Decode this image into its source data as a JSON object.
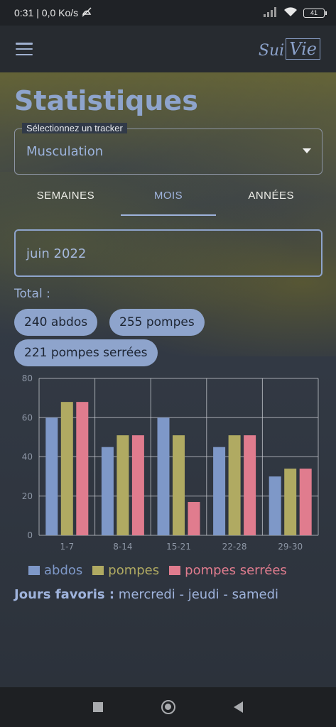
{
  "status": {
    "time": "0:31",
    "speed": "| 0,0 Ko/s",
    "battery": "41"
  },
  "app": {
    "logo_left": "Sui",
    "logo_right": "Vie"
  },
  "page": {
    "title": "Statistiques",
    "tracker_label": "Sélectionnez un tracker",
    "tracker_value": "Musculation",
    "tabs": [
      {
        "label": "SEMAINES",
        "active": false
      },
      {
        "label": "MOIS",
        "active": true
      },
      {
        "label": "ANNÉES",
        "active": false
      }
    ],
    "month_value": "juin 2022",
    "total_label": "Total :",
    "chips": [
      "240 abdos",
      "255 pompes",
      "221 pompes serrées"
    ],
    "favs_label": "Jours favoris :",
    "favs_value": "mercredi - jeudi - samedi"
  },
  "colors": {
    "abdos": "#7e98c8",
    "pompes": "#b0aa62",
    "pompes_serrees": "#e07c8e",
    "accent": "#8ea4cc"
  },
  "chart_data": {
    "type": "bar",
    "categories": [
      "1-7",
      "8-14",
      "15-21",
      "22-28",
      "29-30"
    ],
    "series": [
      {
        "name": "abdos",
        "values": [
          60,
          45,
          60,
          45,
          30
        ]
      },
      {
        "name": "pompes",
        "values": [
          68,
          51,
          51,
          51,
          34
        ]
      },
      {
        "name": "pompes serrées",
        "values": [
          68,
          51,
          17,
          51,
          34
        ]
      }
    ],
    "yticks": [
      0,
      20,
      40,
      60,
      80
    ],
    "ylim": [
      0,
      80
    ],
    "grid": true,
    "legend_position": "bottom"
  }
}
